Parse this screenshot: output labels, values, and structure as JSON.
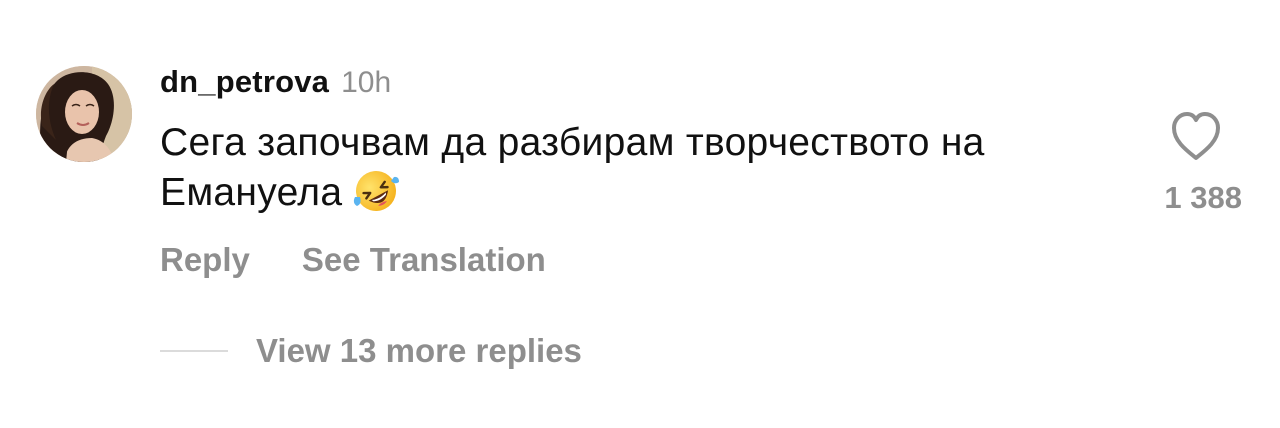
{
  "comment": {
    "avatar_icon": "avatar-photo",
    "username": "dn_petrova",
    "timestamp": "10h",
    "text_line1": "Сега започвам да разбирам творчеството на",
    "text_line2": "Емануела",
    "emoji_icon": "rolling-on-the-floor-laughing-emoji",
    "like_icon": "heart-outline-icon",
    "like_count": "1 388",
    "actions": {
      "reply_label": "Reply",
      "translate_label": "See Translation"
    },
    "replies": {
      "label": "View 13 more replies"
    }
  },
  "colors": {
    "text_primary": "#111111",
    "text_secondary": "#8e8e8e",
    "divider": "#dbdbdb"
  }
}
